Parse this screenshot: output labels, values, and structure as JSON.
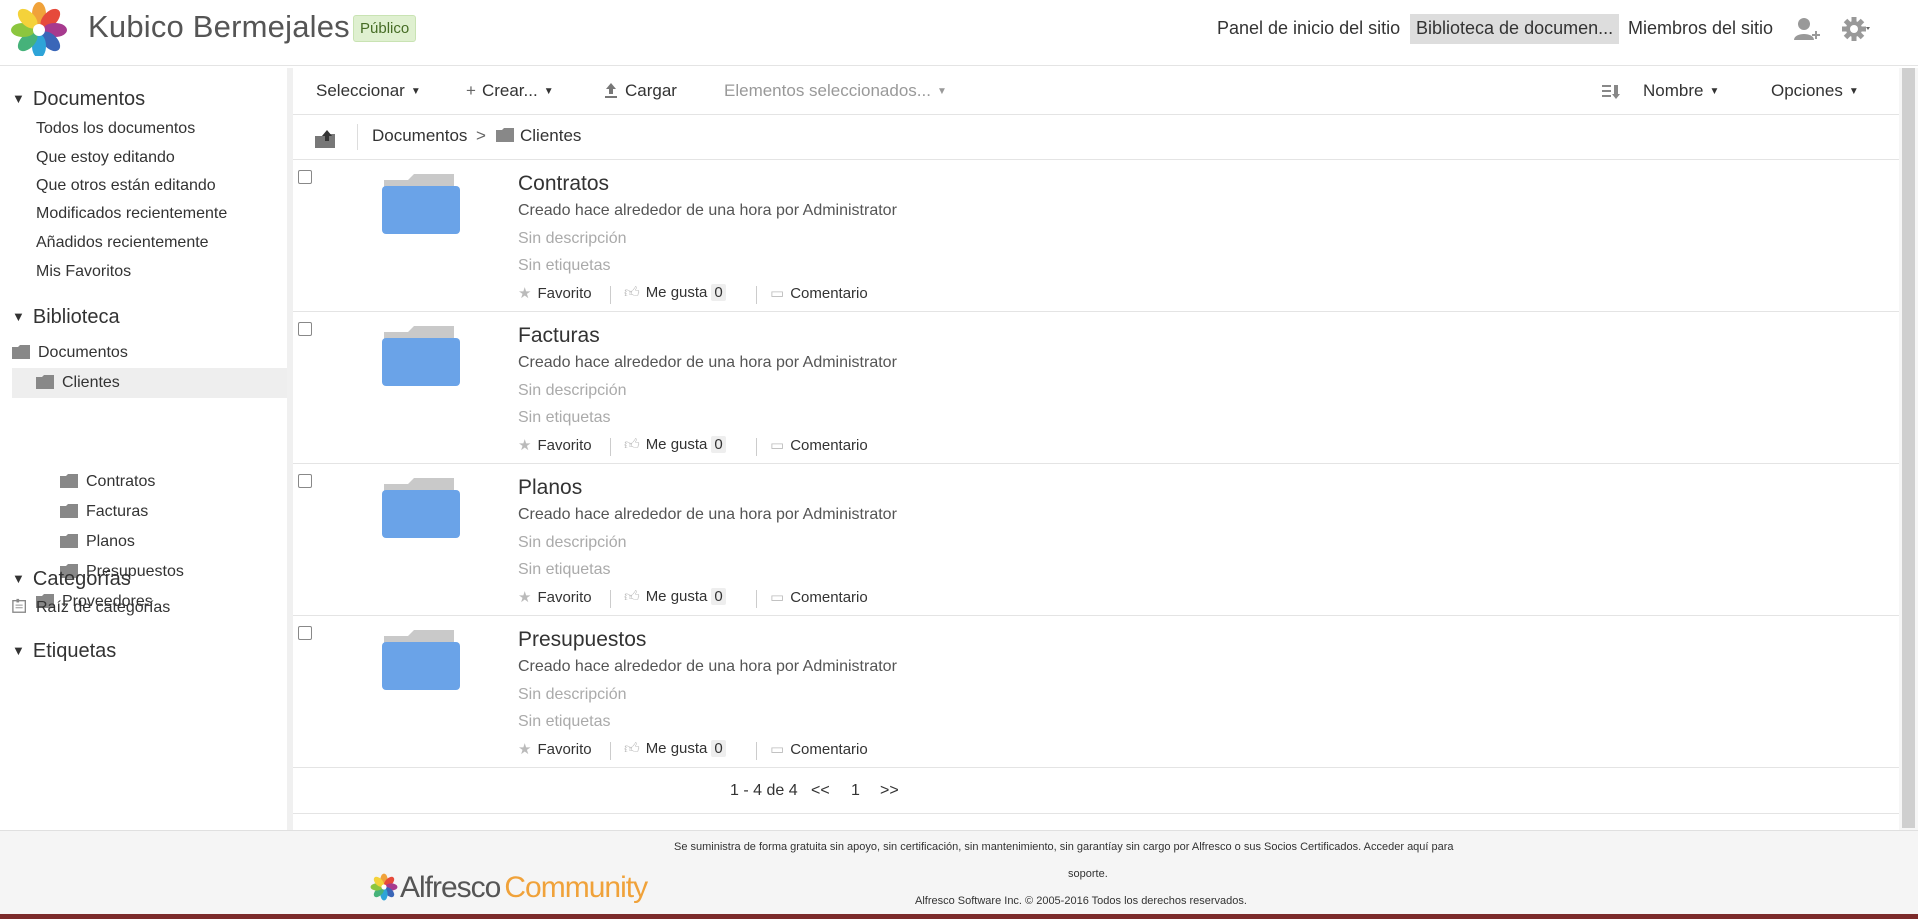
{
  "header": {
    "site_title": "Kubico Bermejales",
    "visibility_badge": "Público",
    "nav": [
      "Panel de inicio del sitio",
      "Biblioteca de documen...",
      "Miembros del sitio"
    ]
  },
  "toolbar": {
    "select_label": "Seleccionar",
    "create_label": "Crear...",
    "upload_label": "Cargar",
    "selected_items_label": "Elementos seleccionados...",
    "sort_label": "Nombre",
    "options_label": "Opciones"
  },
  "breadcrumb": {
    "root": "Documentos",
    "separator": ">",
    "current": "Clientes"
  },
  "sidebar": {
    "documents_header": "Documentos",
    "document_filters": [
      "Todos los documentos",
      "Que estoy editando",
      "Que otros están editando",
      "Modificados recientemente",
      "Añadidos recientemente",
      "Mis Favoritos"
    ],
    "library_header": "Biblioteca",
    "tree": {
      "root": "Documentos",
      "selected": "Clientes",
      "children": [
        "Contratos",
        "Facturas",
        "Planos",
        "Presupuestos"
      ],
      "sibling": "Proveedores"
    },
    "categories_header": "Categorías",
    "categories_root": "Raíz de categorías",
    "tags_header": "Etiquetas"
  },
  "items": [
    {
      "name": "Contratos",
      "meta": "Creado hace alrededor de una hora por Administrator",
      "description": "Sin descripción",
      "tags": "Sin etiquetas",
      "favorite": "Favorito",
      "like": "Me gusta",
      "like_count": "0",
      "comment": "Comentario"
    },
    {
      "name": "Facturas",
      "meta": "Creado hace alrededor de una hora por Administrator",
      "description": "Sin descripción",
      "tags": "Sin etiquetas",
      "favorite": "Favorito",
      "like": "Me gusta",
      "like_count": "0",
      "comment": "Comentario"
    },
    {
      "name": "Planos",
      "meta": "Creado hace alrededor de una hora por Administrator",
      "description": "Sin descripción",
      "tags": "Sin etiquetas",
      "favorite": "Favorito",
      "like": "Me gusta",
      "like_count": "0",
      "comment": "Comentario"
    },
    {
      "name": "Presupuestos",
      "meta": "Creado hace alrededor de una hora por Administrator",
      "description": "Sin descripción",
      "tags": "Sin etiquetas",
      "favorite": "Favorito",
      "like": "Me gusta",
      "like_count": "0",
      "comment": "Comentario"
    }
  ],
  "pager": {
    "range": "1 - 4 de 4",
    "prev": "<<",
    "page": "1",
    "next": ">>"
  },
  "footer": {
    "line1": "Se suministra de forma gratuita sin apoyo, sin certificación, sin mantenimiento, sin garantíay sin cargo por Alfresco o sus Socios Certificados. Acceder aquí para",
    "line2": "soporte.",
    "line3": "Alfresco Software Inc. © 2005-2016 Todos los derechos reservados.",
    "logo_word1": "Alfresco",
    "logo_word2": "Community"
  },
  "colors": {
    "folder_blue": "#6aa3e8",
    "folder_tab": "#c9c9c9",
    "badge_green": "#dff0d0",
    "community_orange": "#f0a23a"
  },
  "icons": [
    "alfresco-logo-icon",
    "add-user-icon",
    "gear-icon",
    "plus-icon",
    "upload-icon",
    "sort-icon",
    "folder-up-icon",
    "folder-icon",
    "star-icon",
    "thumbs-up-icon",
    "comment-icon",
    "category-icon"
  ]
}
